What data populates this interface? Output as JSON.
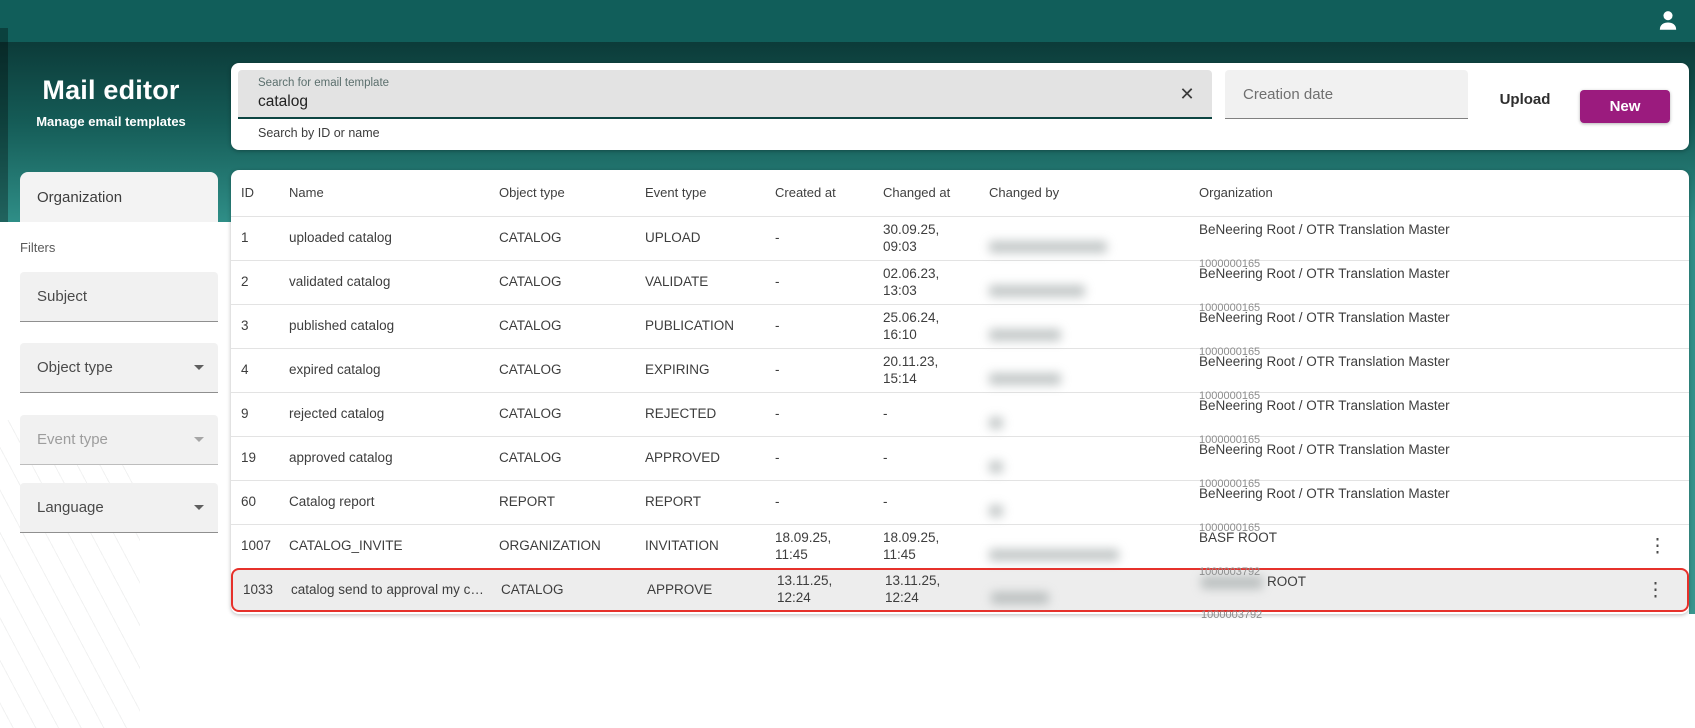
{
  "colors": {
    "topbar_teal": "#115e5a",
    "gradient_dark": "#0c3b39",
    "gradient_light": "#2f8e87",
    "new_button_magenta": "#9b1b7e",
    "highlight_red": "#e6312b"
  },
  "topbar": {
    "user_icon": "person-icon"
  },
  "sidebar": {
    "title": "Mail editor",
    "subtitle": "Manage email templates",
    "organization_tab": "Organization",
    "filters_label": "Filters",
    "filters": [
      {
        "label": "Subject",
        "has_arrow": false,
        "muted": false
      },
      {
        "label": "Object type",
        "has_arrow": true,
        "muted": false
      },
      {
        "label": "Event type",
        "has_arrow": true,
        "muted": true
      },
      {
        "label": "Language",
        "has_arrow": true,
        "muted": false
      }
    ]
  },
  "toolbar": {
    "search": {
      "label": "Search for email template",
      "value": "catalog",
      "clear_icon": "✕",
      "hint": "Search by ID or name"
    },
    "creation_date_placeholder": "Creation date",
    "upload_label": "Upload",
    "new_label": "New"
  },
  "table": {
    "columns": [
      "ID",
      "Name",
      "Object type",
      "Event type",
      "Created at",
      "Changed at",
      "Changed by",
      "Organization"
    ],
    "rows": [
      {
        "id": "1",
        "name": "uploaded catalog",
        "object_type": "CATALOG",
        "event_type": "UPLOAD",
        "created_at": "-",
        "changed_at": "30.09.25, 09:03",
        "changed_by_redacted": true,
        "changed_by_blur_width": 118,
        "org": {
          "name": "BeNeering Root / OTR Translation Master",
          "code": "1000000165"
        },
        "kebab": false,
        "highlighted": false
      },
      {
        "id": "2",
        "name": "validated catalog",
        "object_type": "CATALOG",
        "event_type": "VALIDATE",
        "created_at": "-",
        "changed_at": "02.06.23, 13:03",
        "changed_by_redacted": true,
        "changed_by_blur_width": 96,
        "org": {
          "name": "BeNeering Root / OTR Translation Master",
          "code": "1000000165"
        },
        "kebab": false,
        "highlighted": false
      },
      {
        "id": "3",
        "name": "published catalog",
        "object_type": "CATALOG",
        "event_type": "PUBLICATION",
        "created_at": "-",
        "changed_at": "25.06.24, 16:10",
        "changed_by_redacted": true,
        "changed_by_blur_width": 72,
        "org": {
          "name": "BeNeering Root / OTR Translation Master",
          "code": "1000000165"
        },
        "kebab": false,
        "highlighted": false
      },
      {
        "id": "4",
        "name": "expired catalog",
        "object_type": "CATALOG",
        "event_type": "EXPIRING",
        "created_at": "-",
        "changed_at": "20.11.23, 15:14",
        "changed_by_redacted": true,
        "changed_by_blur_width": 72,
        "org": {
          "name": "BeNeering Root / OTR Translation Master",
          "code": "1000000165"
        },
        "kebab": false,
        "highlighted": false
      },
      {
        "id": "9",
        "name": "rejected catalog",
        "object_type": "CATALOG",
        "event_type": "REJECTED",
        "created_at": "-",
        "changed_at": "-",
        "changed_by_redacted": true,
        "changed_by_blur_width": 14,
        "org": {
          "name": "BeNeering Root / OTR Translation Master",
          "code": "1000000165"
        },
        "kebab": false,
        "highlighted": false
      },
      {
        "id": "19",
        "name": "approved catalog",
        "object_type": "CATALOG",
        "event_type": "APPROVED",
        "created_at": "-",
        "changed_at": "-",
        "changed_by_redacted": true,
        "changed_by_blur_width": 14,
        "org": {
          "name": "BeNeering Root / OTR Translation Master",
          "code": "1000000165"
        },
        "kebab": false,
        "highlighted": false
      },
      {
        "id": "60",
        "name": "Catalog report",
        "object_type": "REPORT",
        "event_type": "REPORT",
        "created_at": "-",
        "changed_at": "-",
        "changed_by_redacted": true,
        "changed_by_blur_width": 14,
        "org": {
          "name": "BeNeering Root / OTR Translation Master",
          "code": "1000000165"
        },
        "kebab": false,
        "highlighted": false
      },
      {
        "id": "1007",
        "name": "CATALOG_INVITE",
        "object_type": "ORGANIZATION",
        "event_type": "INVITATION",
        "created_at": "18.09.25, 11:45",
        "changed_at": "18.09.25, 11:45",
        "changed_by_redacted": true,
        "changed_by_blur_width": 130,
        "org": {
          "name": "BASF ROOT",
          "code": "1000003792"
        },
        "kebab": true,
        "highlighted": false
      },
      {
        "id": "1033",
        "name": "catalog send to approval my co…",
        "object_type": "CATALOG",
        "event_type": "APPROVE",
        "created_at": "13.11.25, 12:24",
        "changed_at": "13.11.25, 12:24",
        "changed_by_redacted": true,
        "changed_by_blur_width": 58,
        "org": {
          "name": "ROOT",
          "code": "1000003792",
          "redacted_prefix": true,
          "redacted_prefix_width": 62
        },
        "kebab": true,
        "highlighted": true
      }
    ]
  }
}
